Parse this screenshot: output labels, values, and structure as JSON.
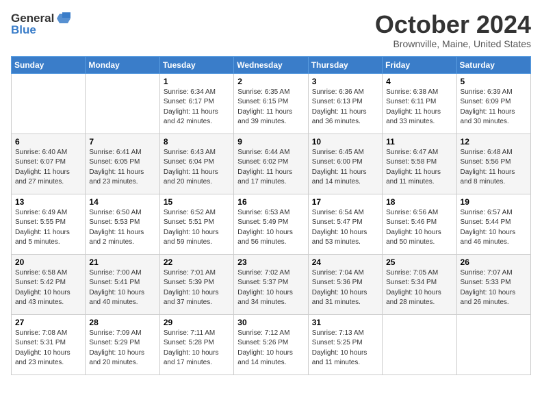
{
  "header": {
    "logo_general": "General",
    "logo_blue": "Blue",
    "title": "October 2024",
    "subtitle": "Brownville, Maine, United States"
  },
  "weekdays": [
    "Sunday",
    "Monday",
    "Tuesday",
    "Wednesday",
    "Thursday",
    "Friday",
    "Saturday"
  ],
  "weeks": [
    [
      {
        "day": "",
        "detail": ""
      },
      {
        "day": "",
        "detail": ""
      },
      {
        "day": "1",
        "detail": "Sunrise: 6:34 AM\nSunset: 6:17 PM\nDaylight: 11 hours and 42 minutes."
      },
      {
        "day": "2",
        "detail": "Sunrise: 6:35 AM\nSunset: 6:15 PM\nDaylight: 11 hours and 39 minutes."
      },
      {
        "day": "3",
        "detail": "Sunrise: 6:36 AM\nSunset: 6:13 PM\nDaylight: 11 hours and 36 minutes."
      },
      {
        "day": "4",
        "detail": "Sunrise: 6:38 AM\nSunset: 6:11 PM\nDaylight: 11 hours and 33 minutes."
      },
      {
        "day": "5",
        "detail": "Sunrise: 6:39 AM\nSunset: 6:09 PM\nDaylight: 11 hours and 30 minutes."
      }
    ],
    [
      {
        "day": "6",
        "detail": "Sunrise: 6:40 AM\nSunset: 6:07 PM\nDaylight: 11 hours and 27 minutes."
      },
      {
        "day": "7",
        "detail": "Sunrise: 6:41 AM\nSunset: 6:05 PM\nDaylight: 11 hours and 23 minutes."
      },
      {
        "day": "8",
        "detail": "Sunrise: 6:43 AM\nSunset: 6:04 PM\nDaylight: 11 hours and 20 minutes."
      },
      {
        "day": "9",
        "detail": "Sunrise: 6:44 AM\nSunset: 6:02 PM\nDaylight: 11 hours and 17 minutes."
      },
      {
        "day": "10",
        "detail": "Sunrise: 6:45 AM\nSunset: 6:00 PM\nDaylight: 11 hours and 14 minutes."
      },
      {
        "day": "11",
        "detail": "Sunrise: 6:47 AM\nSunset: 5:58 PM\nDaylight: 11 hours and 11 minutes."
      },
      {
        "day": "12",
        "detail": "Sunrise: 6:48 AM\nSunset: 5:56 PM\nDaylight: 11 hours and 8 minutes."
      }
    ],
    [
      {
        "day": "13",
        "detail": "Sunrise: 6:49 AM\nSunset: 5:55 PM\nDaylight: 11 hours and 5 minutes."
      },
      {
        "day": "14",
        "detail": "Sunrise: 6:50 AM\nSunset: 5:53 PM\nDaylight: 11 hours and 2 minutes."
      },
      {
        "day": "15",
        "detail": "Sunrise: 6:52 AM\nSunset: 5:51 PM\nDaylight: 10 hours and 59 minutes."
      },
      {
        "day": "16",
        "detail": "Sunrise: 6:53 AM\nSunset: 5:49 PM\nDaylight: 10 hours and 56 minutes."
      },
      {
        "day": "17",
        "detail": "Sunrise: 6:54 AM\nSunset: 5:47 PM\nDaylight: 10 hours and 53 minutes."
      },
      {
        "day": "18",
        "detail": "Sunrise: 6:56 AM\nSunset: 5:46 PM\nDaylight: 10 hours and 50 minutes."
      },
      {
        "day": "19",
        "detail": "Sunrise: 6:57 AM\nSunset: 5:44 PM\nDaylight: 10 hours and 46 minutes."
      }
    ],
    [
      {
        "day": "20",
        "detail": "Sunrise: 6:58 AM\nSunset: 5:42 PM\nDaylight: 10 hours and 43 minutes."
      },
      {
        "day": "21",
        "detail": "Sunrise: 7:00 AM\nSunset: 5:41 PM\nDaylight: 10 hours and 40 minutes."
      },
      {
        "day": "22",
        "detail": "Sunrise: 7:01 AM\nSunset: 5:39 PM\nDaylight: 10 hours and 37 minutes."
      },
      {
        "day": "23",
        "detail": "Sunrise: 7:02 AM\nSunset: 5:37 PM\nDaylight: 10 hours and 34 minutes."
      },
      {
        "day": "24",
        "detail": "Sunrise: 7:04 AM\nSunset: 5:36 PM\nDaylight: 10 hours and 31 minutes."
      },
      {
        "day": "25",
        "detail": "Sunrise: 7:05 AM\nSunset: 5:34 PM\nDaylight: 10 hours and 28 minutes."
      },
      {
        "day": "26",
        "detail": "Sunrise: 7:07 AM\nSunset: 5:33 PM\nDaylight: 10 hours and 26 minutes."
      }
    ],
    [
      {
        "day": "27",
        "detail": "Sunrise: 7:08 AM\nSunset: 5:31 PM\nDaylight: 10 hours and 23 minutes."
      },
      {
        "day": "28",
        "detail": "Sunrise: 7:09 AM\nSunset: 5:29 PM\nDaylight: 10 hours and 20 minutes."
      },
      {
        "day": "29",
        "detail": "Sunrise: 7:11 AM\nSunset: 5:28 PM\nDaylight: 10 hours and 17 minutes."
      },
      {
        "day": "30",
        "detail": "Sunrise: 7:12 AM\nSunset: 5:26 PM\nDaylight: 10 hours and 14 minutes."
      },
      {
        "day": "31",
        "detail": "Sunrise: 7:13 AM\nSunset: 5:25 PM\nDaylight: 10 hours and 11 minutes."
      },
      {
        "day": "",
        "detail": ""
      },
      {
        "day": "",
        "detail": ""
      }
    ]
  ]
}
